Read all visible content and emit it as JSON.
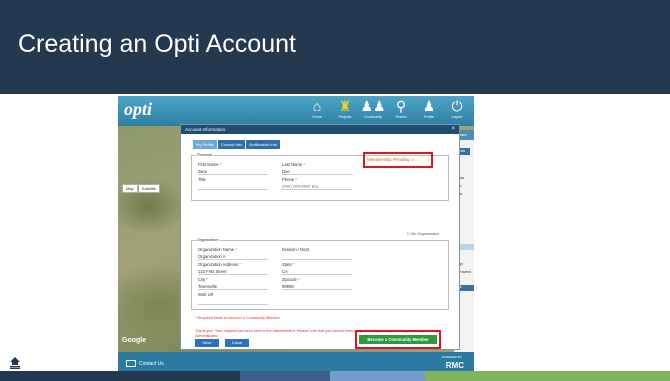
{
  "slide": {
    "title": "Creating an Opti Account",
    "footer_colors": [
      "#24384f",
      "#24384f",
      "#3a5f8c",
      "#6e9ec9",
      "#80b55d",
      "#80b55d"
    ]
  },
  "app": {
    "logo": "opti",
    "nav": [
      {
        "label": "Home",
        "icon": "home-icon",
        "glyph": "⌂"
      },
      {
        "label": "Projects",
        "icon": "projects-icon",
        "glyph": "♜"
      },
      {
        "label": "Community",
        "icon": "community-icon",
        "glyph": "♟♟"
      },
      {
        "label": "Search",
        "icon": "search-icon",
        "glyph": "⚲"
      },
      {
        "label": "Profile",
        "icon": "profile-icon",
        "glyph": "♟"
      },
      {
        "label": "Logout",
        "icon": "power-icon",
        "glyph": "⏻"
      }
    ],
    "map": {
      "buttons": [
        "Map",
        "Satellite"
      ],
      "attribution": "Google"
    },
    "side": {
      "header": "Share",
      "button": "Tools",
      "items": [
        "ile",
        "ojects",
        "ects",
        "jects",
        "ual",
        "ssign",
        "e-Proceed"
      ],
      "band": "ack"
    },
    "bottom": {
      "contact": "Contact Us",
      "powered": "POWERED BY",
      "brand": "RMC"
    }
  },
  "dialog": {
    "title": "Account Information",
    "close": "×",
    "tabs": [
      "My Profile",
      "Contact Info",
      "Notification Info"
    ],
    "personal": {
      "legend": "Personal",
      "first_name_label": "First Name",
      "first_name": "Jane",
      "last_name_label": "Last Name",
      "last_name": "Doe",
      "title_label": "Title",
      "phone_label": "Phone",
      "phone_placeholder": "(###) ###-#### Ext.",
      "req": "*"
    },
    "warning": "Membership Pending",
    "warning_icon": "⚠",
    "no_org": "No Organization",
    "organization": {
      "legend": "Organization",
      "org_name_label": "Organization Name",
      "org_name": "Organization A",
      "division_label": "Division / Dept.",
      "address_label": "Organization Address",
      "address": "123 First Street",
      "state_label": "State",
      "state": "CA",
      "city_label": "City",
      "city": "Townsville",
      "zip_label": "Zipcode",
      "zip": "99999",
      "web_label": "Web Url"
    },
    "required_note": "* Required fields to become a Community Member",
    "thank_you": "Thank you. Your request has been sent to the Administrator. Please note that you cannot enter projects until your request is approved by the Administrator.",
    "save": "Save",
    "close_button": "Close",
    "become_member": "Become a Community Member"
  }
}
